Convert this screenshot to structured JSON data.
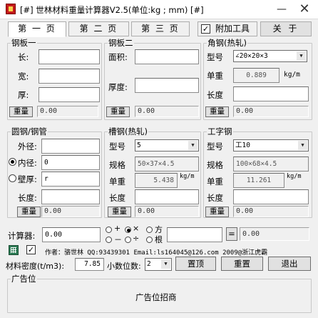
{
  "window": {
    "title": "[#] 世林材料重量计算器V2.5(单位:kg ; mm) [#]",
    "minimize": "—",
    "close": "✕"
  },
  "tabs": [
    "第 一 页",
    "第 二 页",
    "第 三 页"
  ],
  "toolbar": {
    "attach_tools": "附加工具",
    "attach_checked": "✓",
    "about": "关 于"
  },
  "weight_button": "重量",
  "plate1": {
    "title": "钢板一",
    "length_label": "长:",
    "width_label": "宽:",
    "thick_label": "厚:",
    "length": "",
    "width": "",
    "thick": "",
    "result": "0.00"
  },
  "plate2": {
    "title": "钢板二",
    "area_label": "面积:",
    "thick_label": "厚度:",
    "area": "",
    "thick": "",
    "result": "0.00"
  },
  "angle": {
    "title": "角钢(热轧)",
    "model_label": "型号",
    "model": "∠20×20×3",
    "unit_weight_label": "单重",
    "unit_weight": "0.889",
    "unit": "kg/m",
    "length_label": "长度",
    "length": "",
    "result": "0.00"
  },
  "round": {
    "title": "圆钢/钢管",
    "outer_label": "外径:",
    "outer": "",
    "inner_label": "内径:",
    "inner": "0",
    "wall_label": "壁厚:",
    "wall": "r",
    "length_label": "长度:",
    "length": "",
    "result": "0.00"
  },
  "channel": {
    "title": "槽钢(热轧)",
    "model_label": "型号",
    "model": "5",
    "spec_label": "规格",
    "spec": "50×37×4.5",
    "unit_weight_label": "单重",
    "unit_weight": "5.438",
    "unit": "kg/m",
    "length_label": "长度",
    "length": "",
    "result": "0.00"
  },
  "ibeam": {
    "title": "工字钢",
    "model_label": "型号",
    "model": "工10",
    "spec_label": "规格",
    "spec": "100×68×4.5",
    "unit_weight_label": "单重",
    "unit_weight": "11.261",
    "unit": "kg/m",
    "length_label": "长度",
    "length": "",
    "result": "0.00"
  },
  "calculator": {
    "label": "计算器:",
    "input1": "0.00",
    "op_plus": "+",
    "op_minus": "－",
    "op_mul": "×",
    "op_div": "÷",
    "op_pow": "方",
    "op_root": "根",
    "input2": "",
    "equals": "=",
    "result": "0.00"
  },
  "footer": {
    "checked": "✓",
    "author": "作者：骆世林 QQ:93439301 Email:ls164045@126.com  2009@浙江虎霸",
    "density_label": "材料密度(t/m3):",
    "density": "7.85",
    "decimals_label": "小数位数:",
    "decimals": "2",
    "top_button": "置顶",
    "reset_button": "重置",
    "exit_button": "退出"
  },
  "ad": {
    "title": "广告位",
    "text": "广告位招商"
  }
}
